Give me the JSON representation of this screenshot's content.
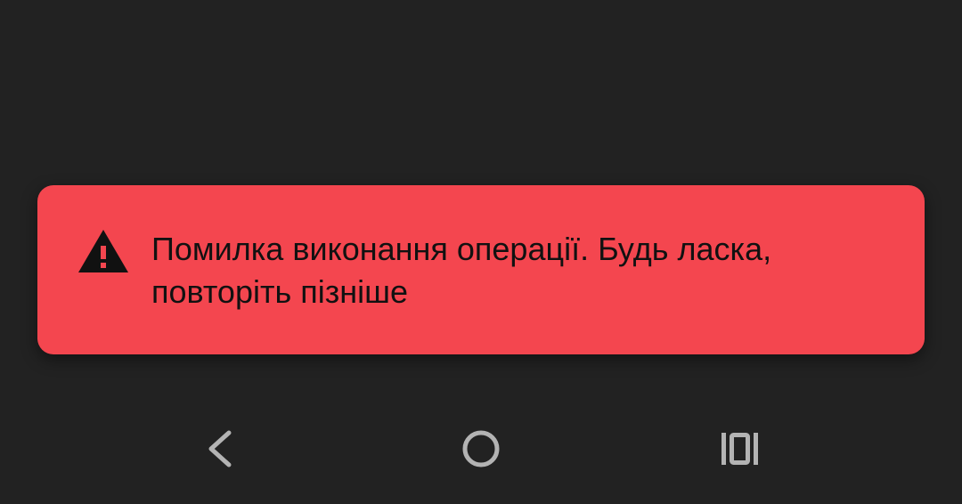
{
  "toast": {
    "message": "Помилка виконання операції. Будь ласка, повторіть пізніше",
    "icon": "warning-icon",
    "background_color": "#f4464f",
    "text_color": "#111111"
  },
  "navigation_bar": {
    "buttons": [
      {
        "icon": "back-chevron-icon"
      },
      {
        "icon": "home-circle-icon"
      },
      {
        "icon": "recents-icon"
      }
    ],
    "icon_color": "#b3b3b3"
  },
  "screen": {
    "background_color": "#222222"
  }
}
